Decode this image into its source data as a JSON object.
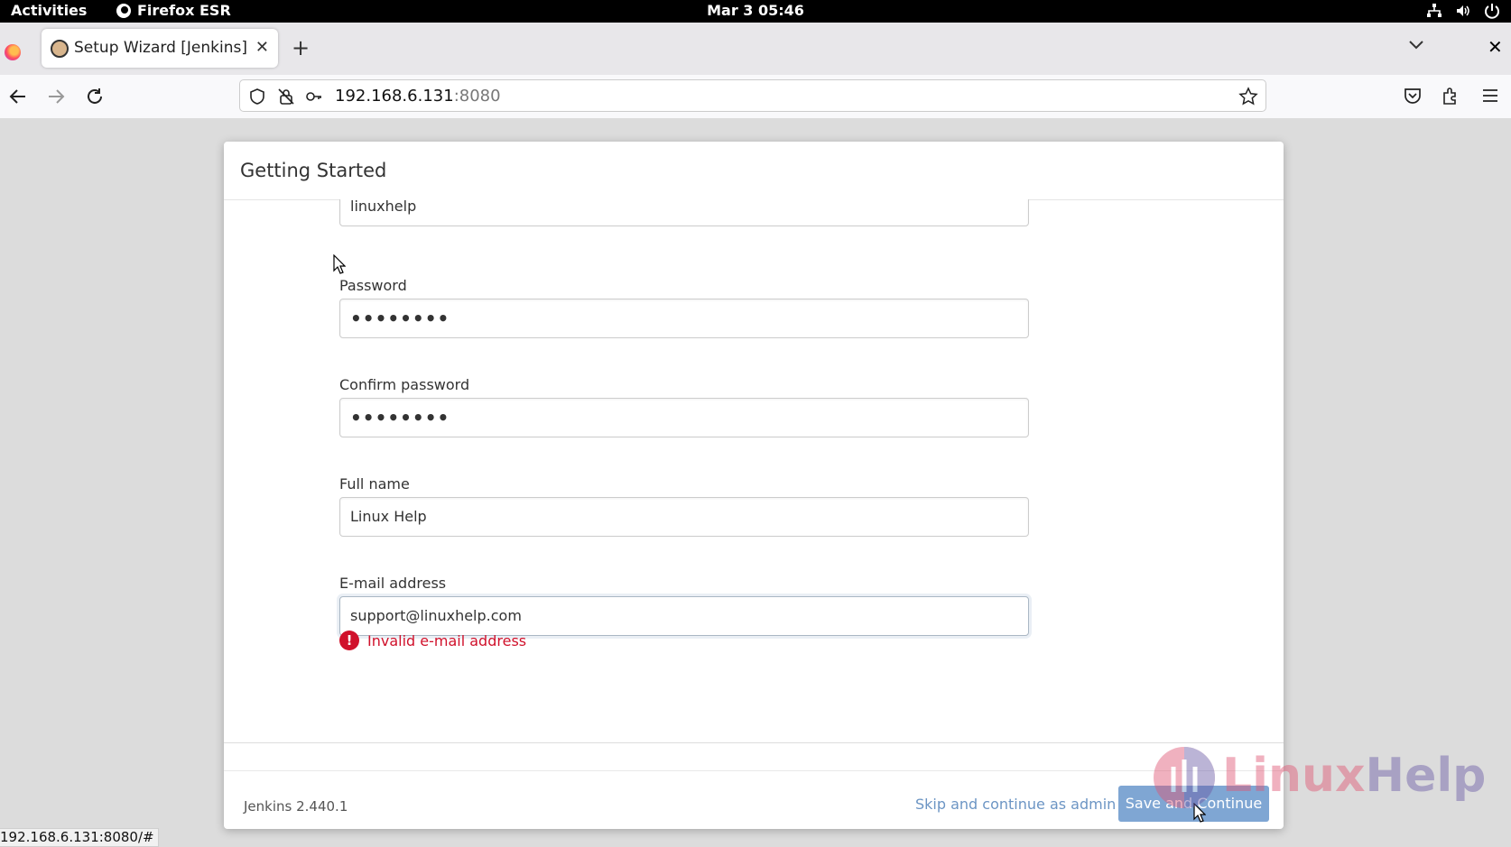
{
  "system_bar": {
    "activities": "Activities",
    "app_name": "Firefox ESR",
    "clock": "Mar 3  05:46"
  },
  "browser": {
    "tab_title": "Setup Wizard [Jenkins]",
    "url_host": "192.168.6.131",
    "url_port": ":8080",
    "status_url": "192.168.6.131:8080/#"
  },
  "dialog": {
    "title": "Getting Started",
    "fields": {
      "username_value": "linuxhelp",
      "password_label": "Password",
      "password_value": "••••••••",
      "confirm_label": "Confirm password",
      "confirm_value": "••••••••",
      "fullname_label": "Full name",
      "fullname_value": "Linux Help",
      "email_label": "E-mail address",
      "email_value": "support@linuxhelp.com"
    },
    "error_text": "Invalid e-mail address",
    "footer": {
      "version": "Jenkins 2.440.1",
      "skip_label": "Skip and continue as admin",
      "save_label": "Save and Continue"
    }
  },
  "watermark": {
    "part1": "Linux",
    "part2": "Help"
  }
}
